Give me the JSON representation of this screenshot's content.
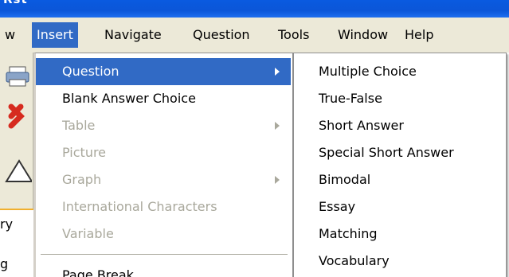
{
  "window": {
    "title_fragment": "Rst"
  },
  "menubar": {
    "items": [
      {
        "label": "w",
        "active": false
      },
      {
        "label": "Insert",
        "active": true
      },
      {
        "label": "Navigate",
        "active": false
      },
      {
        "label": "Question",
        "active": false
      },
      {
        "label": "Tools",
        "active": false
      },
      {
        "label": "Window",
        "active": false
      },
      {
        "label": "Help",
        "active": false
      }
    ]
  },
  "left_panel": {
    "fragments": [
      "ry",
      "g"
    ]
  },
  "insert_menu": {
    "items": [
      {
        "label": "Question",
        "state": "selected",
        "submenu": true
      },
      {
        "label": "Blank Answer Choice",
        "state": "enabled",
        "submenu": false
      },
      {
        "label": "Table",
        "state": "disabled",
        "submenu": true
      },
      {
        "label": "Picture",
        "state": "disabled",
        "submenu": false
      },
      {
        "label": "Graph",
        "state": "disabled",
        "submenu": true
      },
      {
        "label": "International Characters",
        "state": "disabled",
        "submenu": false
      },
      {
        "label": "Variable",
        "state": "disabled",
        "submenu": false
      },
      {
        "label": "Page Break",
        "state": "enabled",
        "submenu": false
      }
    ]
  },
  "question_submenu": {
    "items": [
      "Multiple Choice",
      "True-False",
      "Short Answer",
      "Special Short Answer",
      "Bimodal",
      "Essay",
      "Matching",
      "Vocabulary"
    ]
  },
  "colors": {
    "highlight": "#316ac5",
    "disabled_text": "#a9a89c",
    "menubar_bg": "#ece9d8",
    "titlebar": "#0b56d8"
  }
}
